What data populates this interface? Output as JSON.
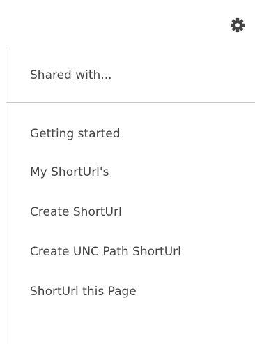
{
  "settings": {
    "icon": "gear-icon",
    "icon_color": "#444444"
  },
  "menu": {
    "shared_item": "Shared with...",
    "items": [
      "Getting started",
      "My ShortUrl's",
      "Create ShortUrl",
      "Create UNC Path ShortUrl",
      "ShortUrl this Page"
    ]
  },
  "colors": {
    "text": "#444444",
    "border": "#c6c6c6",
    "background": "#ffffff"
  }
}
